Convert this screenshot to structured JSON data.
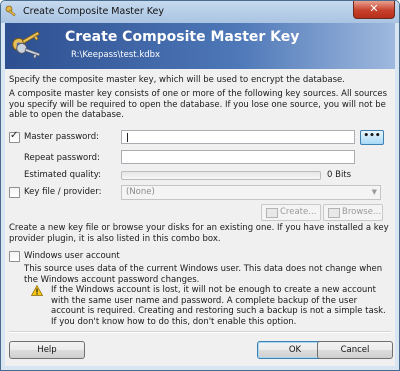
{
  "window": {
    "title": "Create Composite Master Key",
    "close_label": "✕"
  },
  "banner": {
    "title": "Create Composite Master Key",
    "path": "R:\\Keepass\\test.kdbx"
  },
  "intro": {
    "line1": "Specify the composite master key, which will be used to encrypt the database.",
    "line2": "A composite master key consists of one or more of the following key sources. All sources you specify will be required to open the database.  If you lose one source, you will not be able to open the database."
  },
  "master_password": {
    "label": "Master password:",
    "checked": true,
    "value": "",
    "reveal_label": "•••",
    "repeat_label": "Repeat password:",
    "repeat_value": "",
    "quality_label": "Estimated quality:",
    "quality_value": "0 Bits",
    "quality_fraction": 0
  },
  "key_file": {
    "label": "Key file / provider:",
    "checked": false,
    "selected": "(None)",
    "create_label": "Create...",
    "browse_label": "Browse...",
    "help": "Create a new key file or browse your disks for an existing one. If you have installed a key provider plugin, it is also listed in this combo box."
  },
  "windows_account": {
    "label": "Windows user account",
    "checked": false,
    "help": "This source uses data of the current Windows user. This data does not change when the Windows account password changes.",
    "warning": "If the Windows account is lost, it will not be enough to create a new account with the same user name and password. A complete backup of the user account is required. Creating and restoring such a backup is not a simple task. If you don't know how to do this, don't enable this option."
  },
  "buttons": {
    "help": "Help",
    "ok": "OK",
    "cancel": "Cancel"
  },
  "colors": {
    "banner_start": "#2d4f90",
    "banner_end": "#9fb9de",
    "content_bg": "#f0f0f0"
  },
  "icons": {
    "app": "keys-icon",
    "banner": "keys-icon",
    "warning": "warning-icon"
  }
}
